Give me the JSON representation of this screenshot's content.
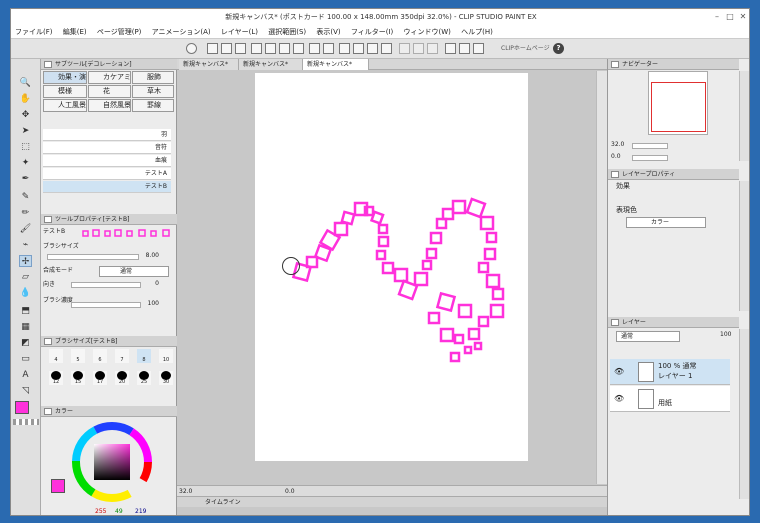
{
  "title_bar": {
    "title": "新規キャンバス* (ポストカード 100.00 x 148.00mm 350dpi 32.0%) - CLIP STUDIO PAINT EX",
    "min": "–",
    "max": "□",
    "close": "✕"
  },
  "menu": [
    "ファイル(F)",
    "編集(E)",
    "ページ管理(P)",
    "アニメーション(A)",
    "レイヤー(L)",
    "選択範囲(S)",
    "表示(V)",
    "フィルター(I)",
    "ウィンドウ(W)",
    "ヘルプ(H)"
  ],
  "toolbar": {
    "clip_home": "CLIPホームページ",
    "help": "?"
  },
  "sub_tool_panel": {
    "tab_label": "サブツール[デコレーション]",
    "groups": [
      "効果・演",
      "カケアミ・",
      "服飾",
      "模様",
      "花",
      "草木",
      "人工風景",
      "自然風景",
      "罫線"
    ],
    "selected_group": "効果・演",
    "items": [
      "羽",
      "音符",
      "血痕",
      "テストA",
      "テストB"
    ],
    "selected_item": "テストB"
  },
  "tool_property": {
    "tab_label": "ツールプロパティ[テストB]",
    "name": "テストB",
    "brush_size_label": "ブラシサイズ",
    "brush_size": "8.00",
    "blend_mode_label": "合成モード",
    "blend_mode": "通常",
    "direction_label": "向き",
    "direction": "0",
    "density_label": "ブラシ濃度",
    "density": "100"
  },
  "brush_size_panel": {
    "tab_label": "ブラシサイズ[テストB]",
    "sizes": [
      "4",
      "5",
      "6",
      "7",
      "8",
      "10",
      "12",
      "15",
      "17",
      "20",
      "25",
      "30"
    ],
    "selected": "8"
  },
  "color_panel": {
    "tab_label": "カラー",
    "r": "255",
    "g": "49",
    "b": "219",
    "main_color": "#ff31db"
  },
  "document_tabs": [
    "新規キャンバス*",
    "新規キャンバス*",
    "新規キャンバス*"
  ],
  "canvas_status": {
    "zoom": "32.0",
    "angle": "0.0",
    "timeline": "タイムライン"
  },
  "navigator": {
    "tab_label": "ナビゲーター",
    "zoom": "32.0",
    "angle": "0.0"
  },
  "layer_property": {
    "tab_label": "レイヤープロパティ",
    "effect_label": "効果",
    "expression_color_label": "表現色",
    "expression_color": "カラー"
  },
  "layer_panel": {
    "tab_label": "レイヤー",
    "blend_mode": "通常",
    "opacity": "100",
    "layers": [
      {
        "line1": "100 % 通常",
        "line2": "レイヤー 1",
        "selected": true
      },
      {
        "line1": "",
        "line2": "用紙",
        "selected": false
      }
    ]
  },
  "colors": {
    "accent": "#ff31db",
    "selection": "#cfe3f3"
  }
}
